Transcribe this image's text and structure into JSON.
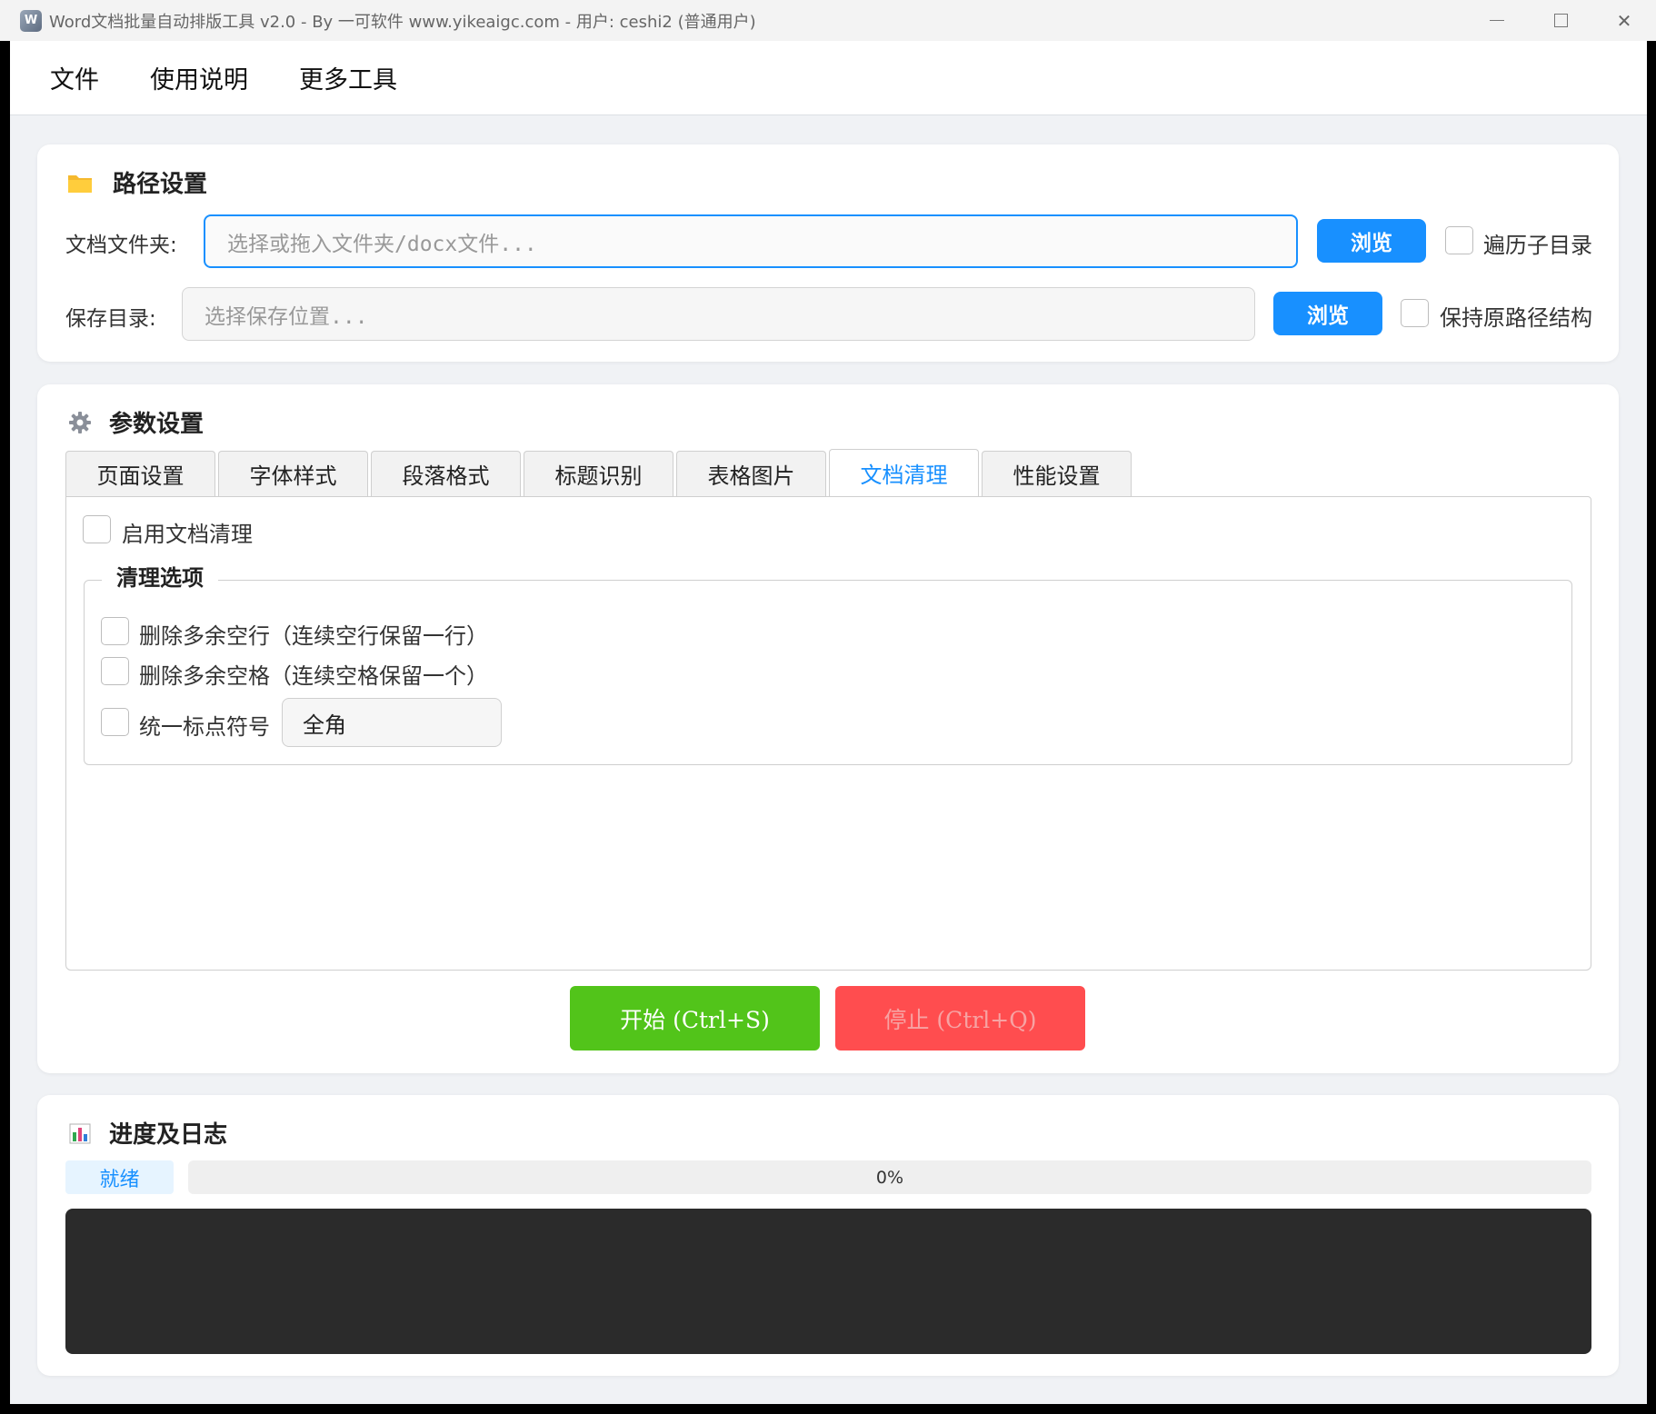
{
  "window": {
    "title": "Word文档批量自动排版工具 v2.0 - By 一可软件 www.yikeaigc.com - 用户: ceshi2 (普通用户)",
    "icon": "app-logo-icon",
    "controls": [
      "minimize-icon",
      "maximize-icon",
      "close-icon"
    ],
    "close_glyph": "✕"
  },
  "menu": {
    "items": [
      "文件",
      "使用说明",
      "更多工具"
    ]
  },
  "path_settings": {
    "title": "路径设置",
    "icon": "folder-icon",
    "doc_folder_label": "文档文件夹:",
    "doc_folder_placeholder": "选择或拖入文件夹/docx文件...",
    "doc_folder_value": "",
    "browse_label": "浏览",
    "recurse_label": "遍历子目录",
    "recurse_checked": false,
    "save_dir_label": "保存目录:",
    "save_dir_placeholder": "选择保存位置...",
    "save_dir_value": "",
    "browse2_label": "浏览",
    "keep_structure_label": "保持原路径结构",
    "keep_structure_checked": false
  },
  "param_settings": {
    "title": "参数设置",
    "icon": "gear-icon",
    "tabs": [
      "页面设置",
      "字体样式",
      "段落格式",
      "标题识别",
      "表格图片",
      "文档清理",
      "性能设置"
    ],
    "active_tab": "文档清理",
    "enable_cleanup_label": "启用文档清理",
    "group_title": "清理选项",
    "options": [
      {
        "label": "删除多余空行（连续空行保留一行）",
        "checked": false
      },
      {
        "label": "删除多余空格（连续空格保留一个）",
        "checked": false
      },
      {
        "label": "统一标点符号",
        "checked": false
      }
    ],
    "punct_select_value": "全角",
    "start_label": "开始 (Ctrl+S)",
    "stop_label": "停止 (Ctrl+Q)",
    "colors": {
      "start": "#52c41a",
      "stop": "#ff4d4f",
      "accent": "#1890ff"
    }
  },
  "progress": {
    "title": "进度及日志",
    "icon": "bar-chart-icon",
    "status": "就绪",
    "percent_text": "0%",
    "percent": 0,
    "log_text": ""
  }
}
